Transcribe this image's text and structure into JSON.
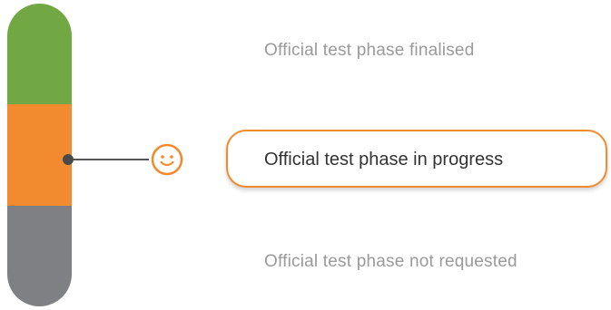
{
  "phases": [
    {
      "label": "Official test phase finalised",
      "status": "done",
      "color": "#72a843"
    },
    {
      "label": "Official test phase in progress",
      "status": "current",
      "color": "#f28a2f"
    },
    {
      "label": "Official test phase not requested",
      "status": "inactive",
      "color": "#7f8083"
    }
  ],
  "current_indicator": {
    "icon": "smiley-face-icon",
    "color": "#f28a2f"
  }
}
